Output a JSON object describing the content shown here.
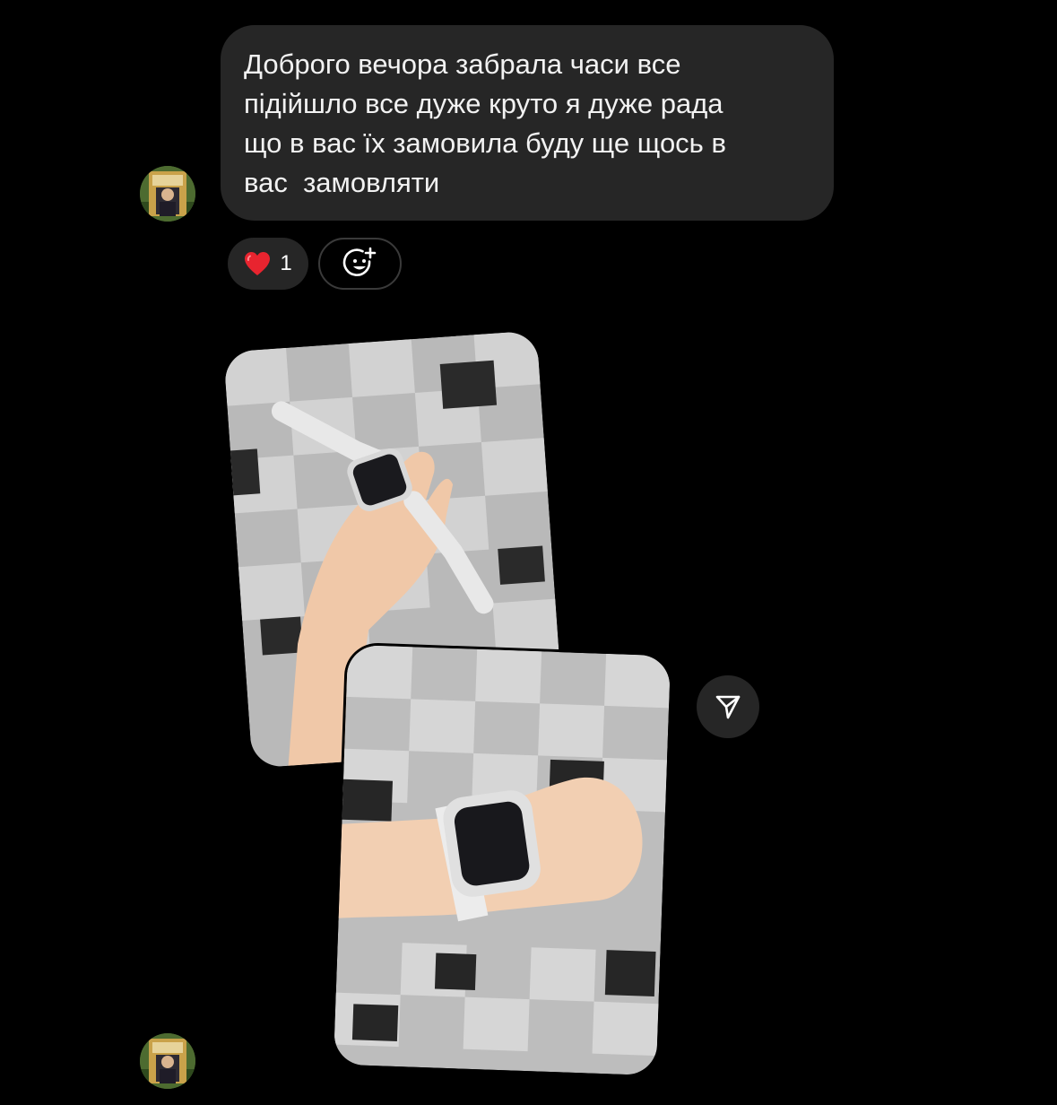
{
  "message": {
    "text": "Доброго вечора забрала часи все\nпідійшло все дуже круто я дуже рада\nщо в вас їх замовила буду ще щось в\nвас  замовляти"
  },
  "reactions": {
    "heart_count": "1",
    "heart_icon": "red-heart-emoji",
    "add_icon": "add-reaction-smiley-icon"
  },
  "colors": {
    "background": "#000000",
    "bubble": "#262626",
    "heart": "#e8242f"
  },
  "icons": {
    "share": "paper-plane-icon"
  }
}
